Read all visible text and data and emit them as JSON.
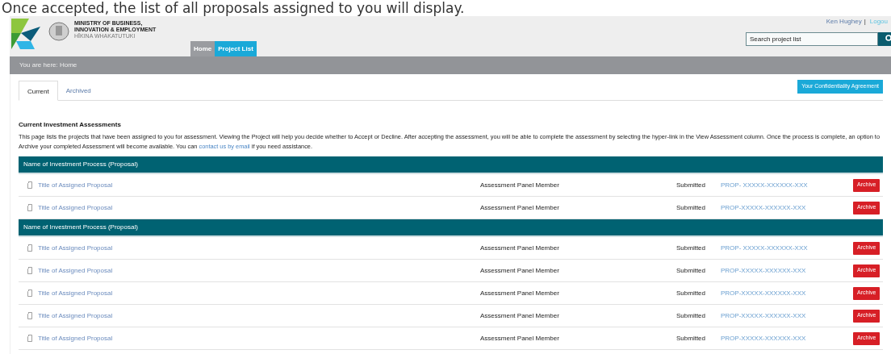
{
  "caption": "Once accepted, the list of all proposals assigned to you will display.",
  "header": {
    "org_name_lines": [
      "MINISTRY OF BUSINESS,",
      "INNOVATION & EMPLOYMENT"
    ],
    "org_subtitle": "HĪKINA WHAKATUTUKI",
    "user": "Ken Hughey",
    "separator": "|",
    "logout": "Logou",
    "search": {
      "placeholder": "Search project list"
    }
  },
  "nav": [
    {
      "label": "Home",
      "selected": true
    },
    {
      "label": "Project List",
      "selected": false
    }
  ],
  "breadcrumb": "You are here: Home",
  "tabs": [
    {
      "label": "Current",
      "selected": true
    },
    {
      "label": "Archived",
      "selected": false
    }
  ],
  "confidentiality_button": "Your Confidentiality Agreement",
  "section": {
    "title": "Current Investment Assessments",
    "intro_before": "This page lists the projects that have been assigned to you for assessment. Viewing the Project will help you decide whether to Accept or Decline. After accepting the assessment, you will be able to complete the assessment by selecting the hyper-link in the View Assessment column. Once the process is complete, an option to Archive your completed Assessment will become available. You can ",
    "intro_link": "contact us by email",
    "intro_after": " if you need assistance."
  },
  "groups": [
    {
      "name": "Name of Investment Process (Proposal)",
      "rows": [
        {
          "title": "Title of Assigned Proposal",
          "role": "Assessment Panel Member",
          "status": "Submitted",
          "reference": "PROP- XXXXX-XXXXXX-XXX",
          "action": "Archive"
        },
        {
          "title": "Title of Assigned Proposal",
          "role": "Assessment Panel Member",
          "status": "Submitted",
          "reference": "PROP-XXXXX-XXXXXX-XXX",
          "action": "Archive"
        }
      ]
    },
    {
      "name": "Name of Investment Process (Proposal)",
      "rows": [
        {
          "title": "Title of Assigned Proposal",
          "role": "Assessment Panel Member",
          "status": "Submitted",
          "reference": "PROP- XXXXX-XXXXXX-XXX",
          "action": "Archive"
        },
        {
          "title": "Title of Assigned Proposal",
          "role": "Assessment Panel Member",
          "status": "Submitted",
          "reference": "PROP-XXXXX-XXXXXX-XXX",
          "action": "Archive"
        },
        {
          "title": "Title of Assigned Proposal",
          "role": "Assessment Panel Member",
          "status": "Submitted",
          "reference": "PROP-XXXXX-XXXXXX-XXX",
          "action": "Archive"
        },
        {
          "title": "Title of Assigned Proposal",
          "role": "Assessment Panel Member",
          "status": "Submitted",
          "reference": "PROP-XXXXX-XXXXXX-XXX",
          "action": "Archive"
        },
        {
          "title": "Title of Assigned Proposal",
          "role": "Assessment Panel Member",
          "status": "Submitted",
          "reference": "PROP-XXXXX-XXXXXX-XXX",
          "action": "Archive"
        }
      ]
    }
  ]
}
